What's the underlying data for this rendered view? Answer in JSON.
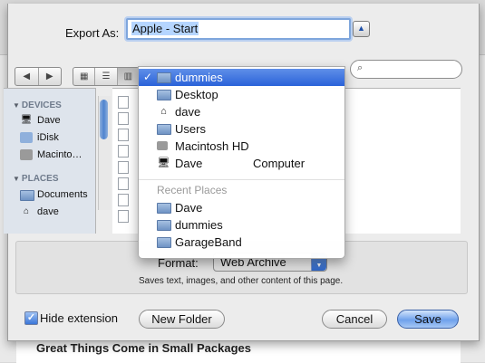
{
  "export": {
    "label": "Export As:",
    "filename": "Apple - Start"
  },
  "toolbar": {
    "back": "◀",
    "forward": "▶",
    "view_icon": "▦",
    "view_list": "☰",
    "view_column": "▥",
    "search_icon": "⌕"
  },
  "sidebar": {
    "devices_header": "DEVICES",
    "devices": [
      {
        "label": "Dave",
        "icon": "imac-icon"
      },
      {
        "label": "iDisk",
        "icon": "idisk-icon"
      },
      {
        "label": "Macinto…",
        "icon": "harddisk-icon"
      }
    ],
    "places_header": "PLACES",
    "places": [
      {
        "label": "Documents",
        "icon": "folder-icon"
      },
      {
        "label": "dave",
        "icon": "home-icon"
      }
    ]
  },
  "location_menu": {
    "selected": "dummies",
    "items": [
      {
        "label": "Desktop",
        "icon": "folder-icon"
      },
      {
        "label": "dave",
        "icon": "home-icon"
      },
      {
        "label": "Users",
        "icon": "folder-icon"
      },
      {
        "label": "Macintosh HD",
        "icon": "harddisk-icon"
      },
      {
        "label": "Dave",
        "label2": "Computer",
        "icon": "computer-icon"
      }
    ],
    "recent_header": "Recent Places",
    "recent": [
      {
        "label": "Dave",
        "icon": "folder-icon"
      },
      {
        "label": "dummies",
        "icon": "folder-icon"
      },
      {
        "label": "GarageBand",
        "icon": "folder-icon"
      }
    ]
  },
  "format": {
    "label": "Format:",
    "value": "Web Archive",
    "description": "Saves text, images, and other content of this page."
  },
  "bottom": {
    "hide_extension_label": "Hide extension",
    "hide_extension_checked": true,
    "new_folder": "New Folder",
    "cancel": "Cancel",
    "save": "Save"
  },
  "background": {
    "article_title": "Great Things Come in Small Packages"
  },
  "colors": {
    "accent": "#2a62d9",
    "sidebar_bg": "#dee4ec"
  }
}
